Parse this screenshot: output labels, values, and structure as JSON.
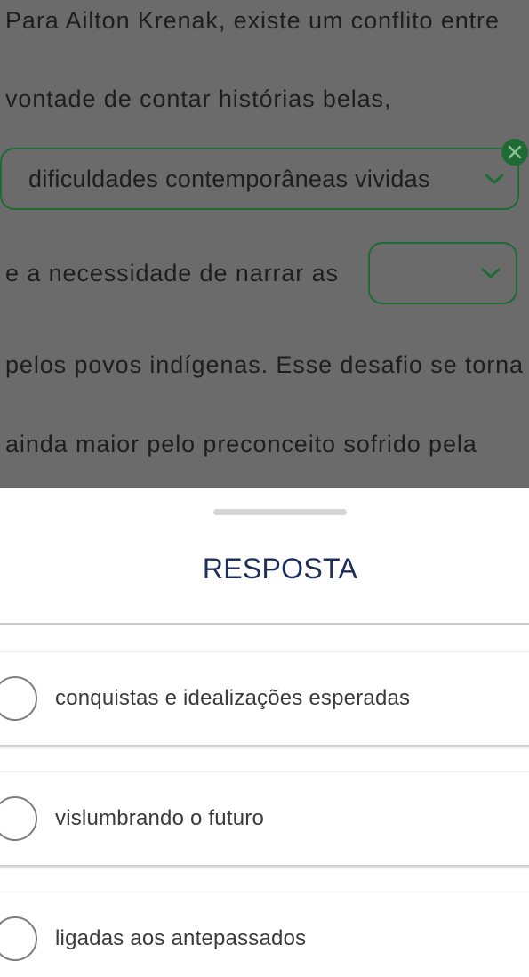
{
  "passage": {
    "line1": "Para Ailton Krenak, existe um conflito entre",
    "line2": "vontade de contar histórias belas,",
    "line3": "e a necessidade de narrar as",
    "line4": "pelos povos indígenas. Esse desafio se torna",
    "line5": "ainda maior pelo preconceito sofrido pela"
  },
  "dropdowns": [
    {
      "selected_value": "dificuldades contemporâneas vividas",
      "has_clear_button": true
    },
    {
      "selected_value": "",
      "has_clear_button": false
    }
  ],
  "sheet": {
    "title": "RESPOSTA",
    "options": [
      {
        "label": "conquistas e idealizações esperadas",
        "selected": false
      },
      {
        "label": "vislumbrando o futuro",
        "selected": false
      },
      {
        "label": "ligadas aos antepassados",
        "selected": false
      }
    ]
  },
  "colors": {
    "overlay": "#6b6b6b",
    "accent_green": "#1f6b33",
    "title_blue": "#1c2e5a"
  },
  "icons": {
    "clear": "close-icon",
    "dropdown": "chevron-down-icon",
    "radio": "radio-unchecked-icon"
  }
}
